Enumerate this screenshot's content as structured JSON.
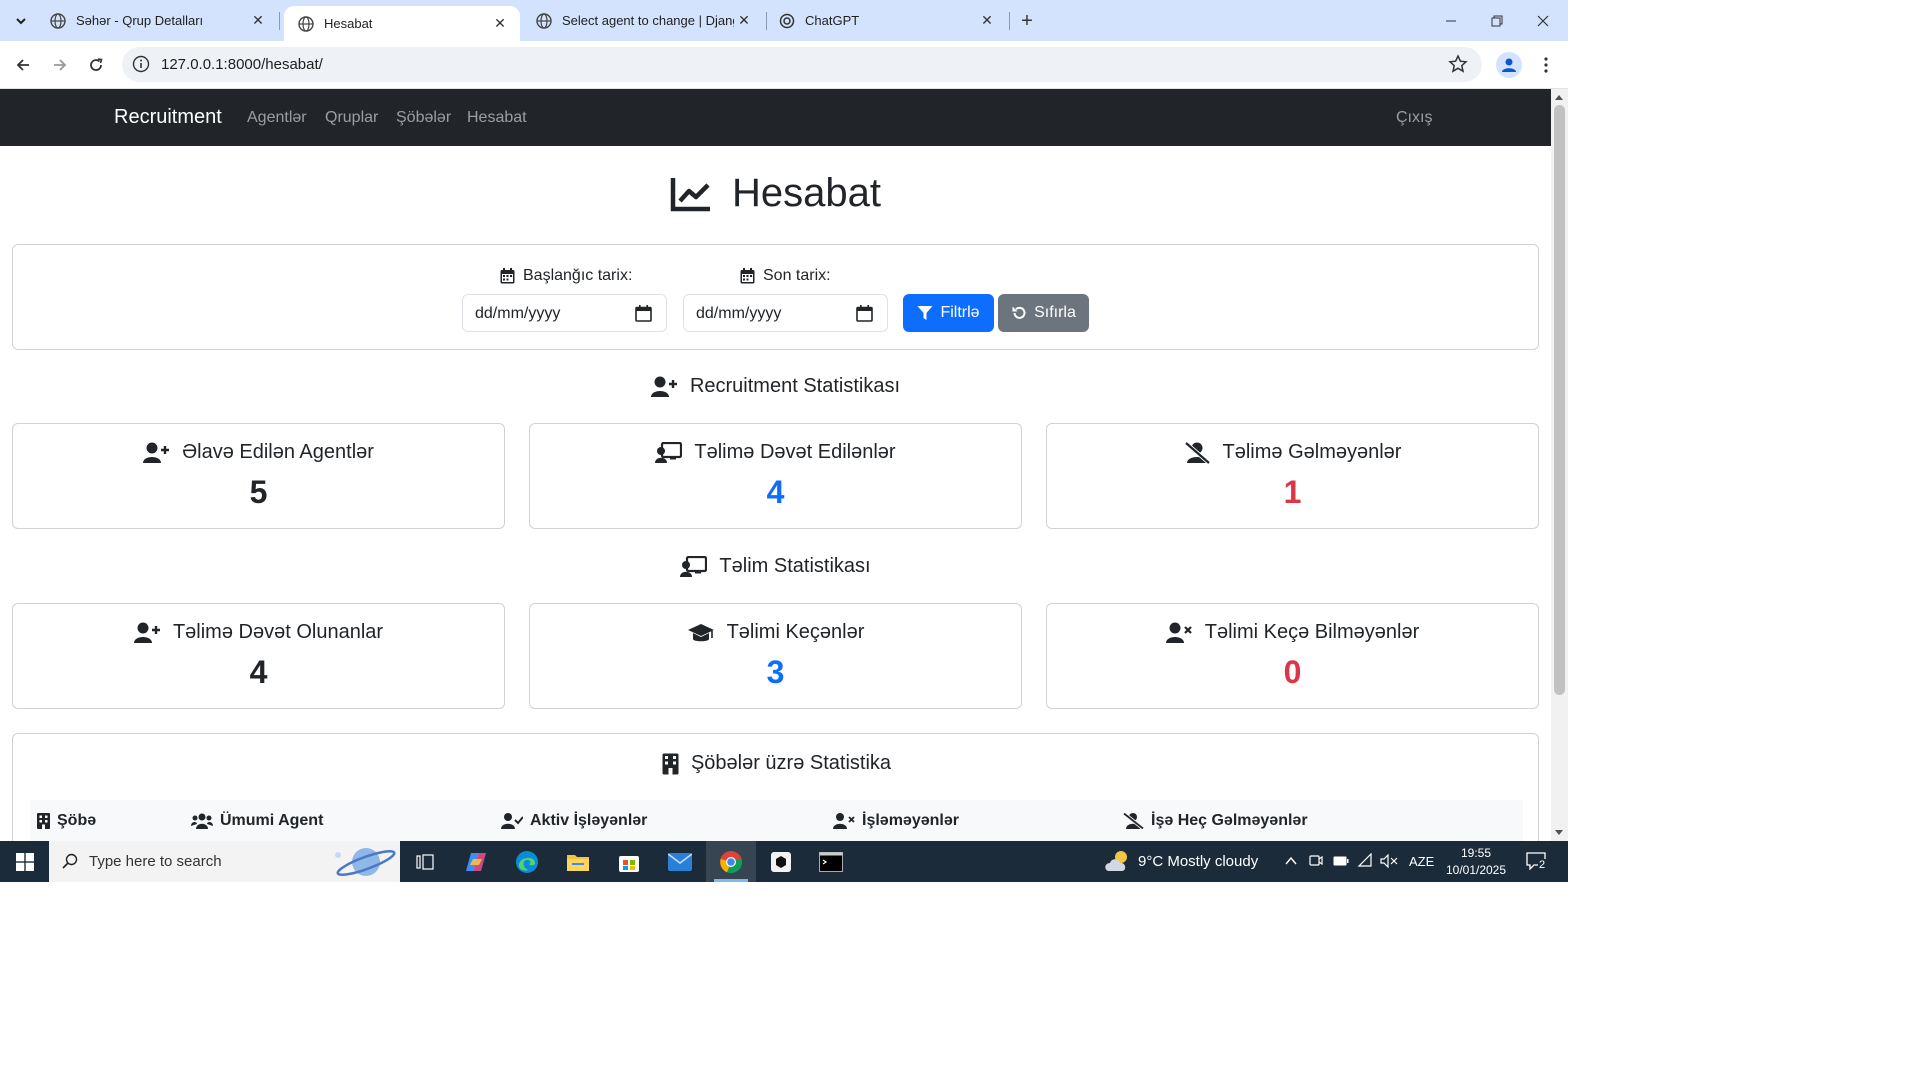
{
  "browser": {
    "tabs": [
      {
        "title": "Səhər - Qrup Detalları",
        "active": false
      },
      {
        "title": "Hesabat",
        "active": true
      },
      {
        "title": "Select agent to change | Django",
        "active": false
      },
      {
        "title": "ChatGPT",
        "active": false
      }
    ],
    "url": "127.0.0.1:8000/hesabat/"
  },
  "navbar": {
    "brand": "Recruitment",
    "links": [
      "Agentlər",
      "Qruplar",
      "Şöbələr",
      "Hesabat"
    ],
    "logout": "Çıxış"
  },
  "page": {
    "title": "Hesabat"
  },
  "filter": {
    "start_label": "Başlanğıc tarix:",
    "end_label": "Son tarix:",
    "start_placeholder": "dd/mm/yyyy",
    "end_placeholder": "dd/mm/yyyy",
    "filter_button": "Filtrlə",
    "reset_button": "Sıfırla"
  },
  "recruitment": {
    "title": "Recruitment Statistikası",
    "cards": [
      {
        "label": "Əlavə Edilən Agentlər",
        "value": "5",
        "icon": "user-plus-icon",
        "color": "#212529"
      },
      {
        "label": "Təlimə Dəvət Edilənlər",
        "value": "4",
        "icon": "chalkboard-teacher-icon",
        "color": "#0d6efd"
      },
      {
        "label": "Təlimə Gəlməyənlər",
        "value": "1",
        "icon": "user-slash-icon",
        "color": "#dc3545"
      }
    ]
  },
  "training": {
    "title": "Təlim Statistikası",
    "cards": [
      {
        "label": "Təlimə Dəvət Olunanlar",
        "value": "4",
        "icon": "user-plus-icon",
        "color": "#212529"
      },
      {
        "label": "Təlimi Keçənlər",
        "value": "3",
        "icon": "graduation-cap-icon",
        "color": "#0d6efd"
      },
      {
        "label": "Təlimi Keçə Bilməyənlər",
        "value": "0",
        "icon": "user-xmark-icon",
        "color": "#dc3545"
      }
    ]
  },
  "departments": {
    "title": "Şöbələr üzrə Statistika",
    "columns": [
      "Şöbə",
      "Ümumi Agent",
      "Aktiv İşləyənlər",
      "İşləməyənlər",
      "İşə Heç Gəlməyənlər"
    ]
  },
  "taskbar": {
    "search_placeholder": "Type here to search",
    "weather": "9°C  Mostly cloudy",
    "language": "AZE",
    "time": "19:55",
    "date": "10/01/2025",
    "notifications": "2"
  }
}
